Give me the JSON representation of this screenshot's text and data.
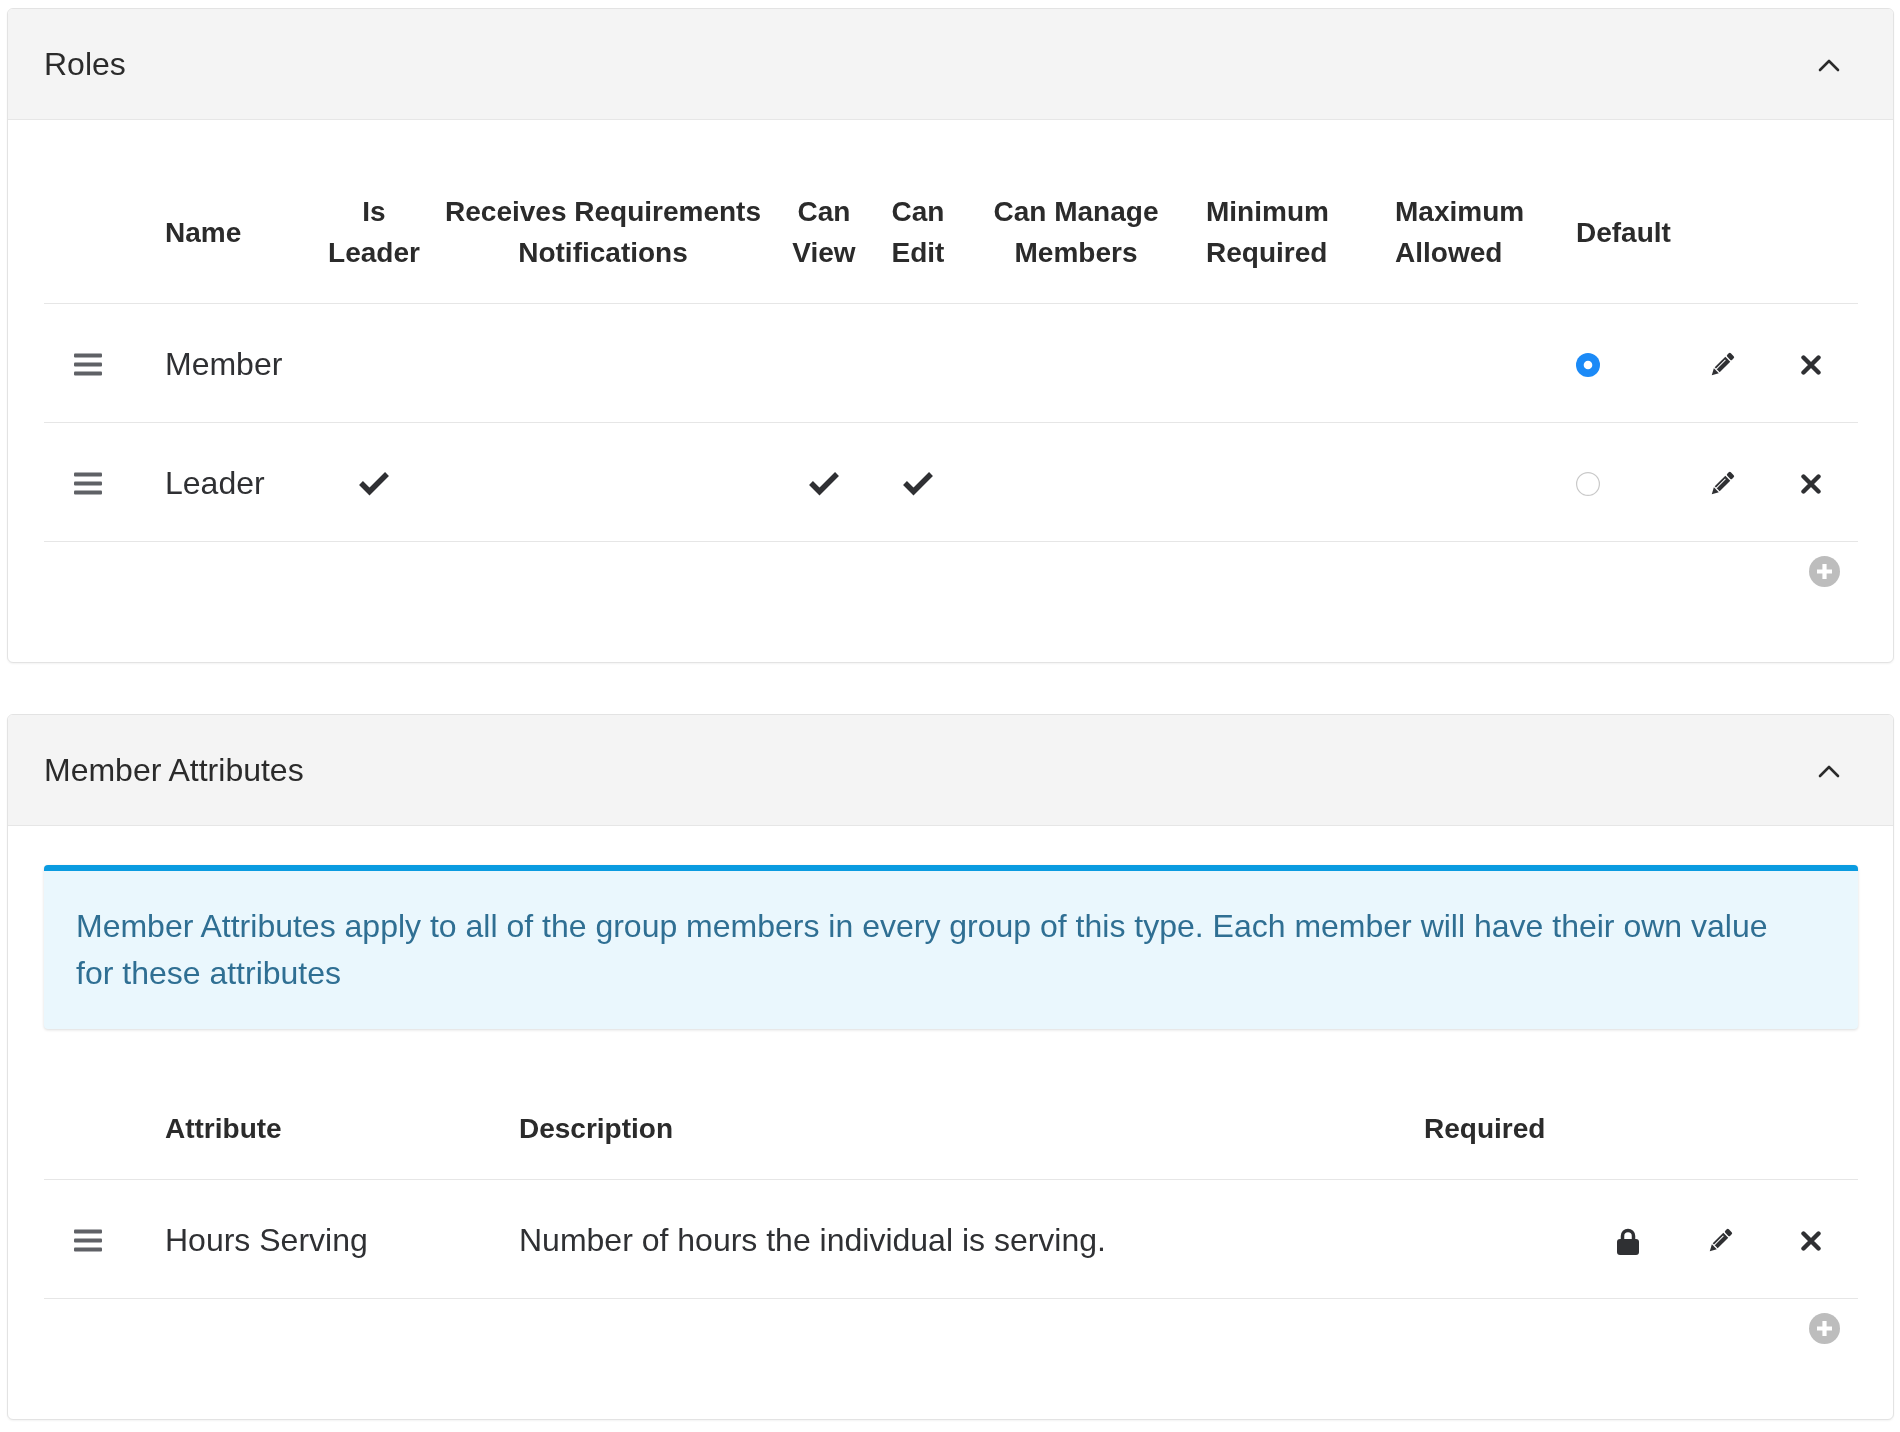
{
  "roles_panel": {
    "title": "Roles",
    "expanded": true,
    "columns": [
      "Name",
      "Is Leader",
      "Receives Requirements Notifications",
      "Can View",
      "Can Edit",
      "Can Manage Members",
      "Minimum Required",
      "Maximum Allowed",
      "Default"
    ],
    "rows": [
      {
        "name": "Member",
        "is_leader": false,
        "receives_requirements_notifications": false,
        "can_view": false,
        "can_edit": false,
        "can_manage_members": false,
        "selected": true
      },
      {
        "name": "Leader",
        "is_leader": true,
        "receives_requirements_notifications": false,
        "can_view": true,
        "can_edit": true,
        "can_manage_members": false,
        "selected": false
      }
    ]
  },
  "member_attributes_panel": {
    "title": "Member Attributes",
    "expanded": true,
    "info": "Member Attributes apply to all of the group members in every group of this type. Each member will have their own value for these attributes",
    "columns": [
      "Attribute",
      "Description",
      "Required"
    ],
    "rows": [
      {
        "name": "Hours Serving",
        "description": "Number of hours the individual is serving.",
        "required": false,
        "locked": true
      }
    ]
  }
}
